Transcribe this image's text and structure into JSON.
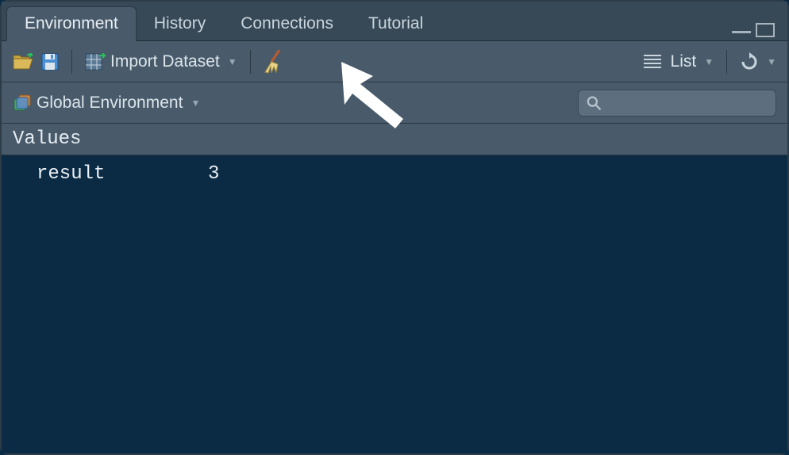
{
  "tabs": {
    "environment": "Environment",
    "history": "History",
    "connections": "Connections",
    "tutorial": "Tutorial"
  },
  "toolbar": {
    "import_dataset_label": "Import Dataset",
    "view_mode_label": "List"
  },
  "scope": {
    "label": "Global Environment",
    "search_placeholder": ""
  },
  "sections": {
    "values_header": "Values"
  },
  "env": {
    "rows": [
      {
        "name": "result",
        "value": "3"
      }
    ]
  }
}
